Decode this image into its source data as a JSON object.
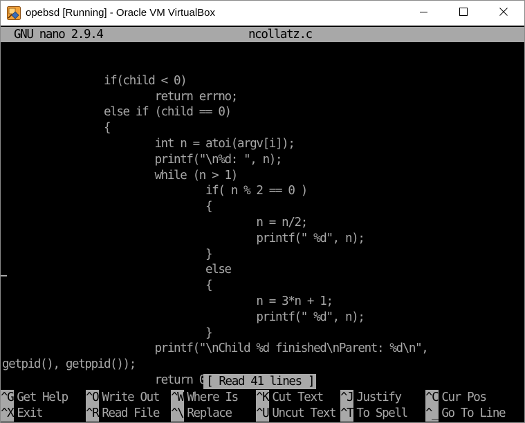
{
  "window": {
    "title": "opebsd [Running] - Oracle VM VirtualBox",
    "icon": "virtualbox-icon",
    "controls": [
      "minimize-icon",
      "maximize-icon",
      "close-icon"
    ]
  },
  "nano": {
    "version": "GNU nano 2.9.4",
    "filename": "ncollatz.c",
    "status": "[ Read 41 lines ]"
  },
  "code_lines": [
    "",
    "                if(child < 0)",
    "                        return errno;",
    "                else if (child == 0)",
    "                {",
    "                        int n = atoi(argv[i]);",
    "                        printf(\"\\n%d: \", n);",
    "                        while (n > 1)",
    "                                if( n % 2 == 0 )",
    "                                {",
    "                                        n = n/2;",
    "                                        printf(\" %d\", n);",
    "                                }",
    "                                else",
    "                                {",
    "                                        n = 3*n + 1;",
    "                                        printf(\" %d\", n);",
    "                                }",
    "                        printf(\"\\nChild %d finished\\nParent: %d\\n\",",
    "getpid(), getppid());",
    "                        return 0;"
  ],
  "shortcuts": [
    {
      "key": "^G",
      "label": "Get Help"
    },
    {
      "key": "^O",
      "label": "Write Out"
    },
    {
      "key": "^W",
      "label": "Where Is"
    },
    {
      "key": "^K",
      "label": "Cut Text"
    },
    {
      "key": "^J",
      "label": "Justify"
    },
    {
      "key": "^C",
      "label": "Cur Pos"
    },
    {
      "key": "^X",
      "label": "Exit"
    },
    {
      "key": "^R",
      "label": "Read File"
    },
    {
      "key": "^\\",
      "label": "Replace"
    },
    {
      "key": "^U",
      "label": "Uncut Text"
    },
    {
      "key": "^T",
      "label": "To Spell"
    },
    {
      "key": "^_",
      "label": "Go To Line"
    }
  ],
  "colors": {
    "terminal_bg": "#000000",
    "terminal_fg": "#a8a8a8",
    "titlebar_bg": "#ffffff"
  }
}
